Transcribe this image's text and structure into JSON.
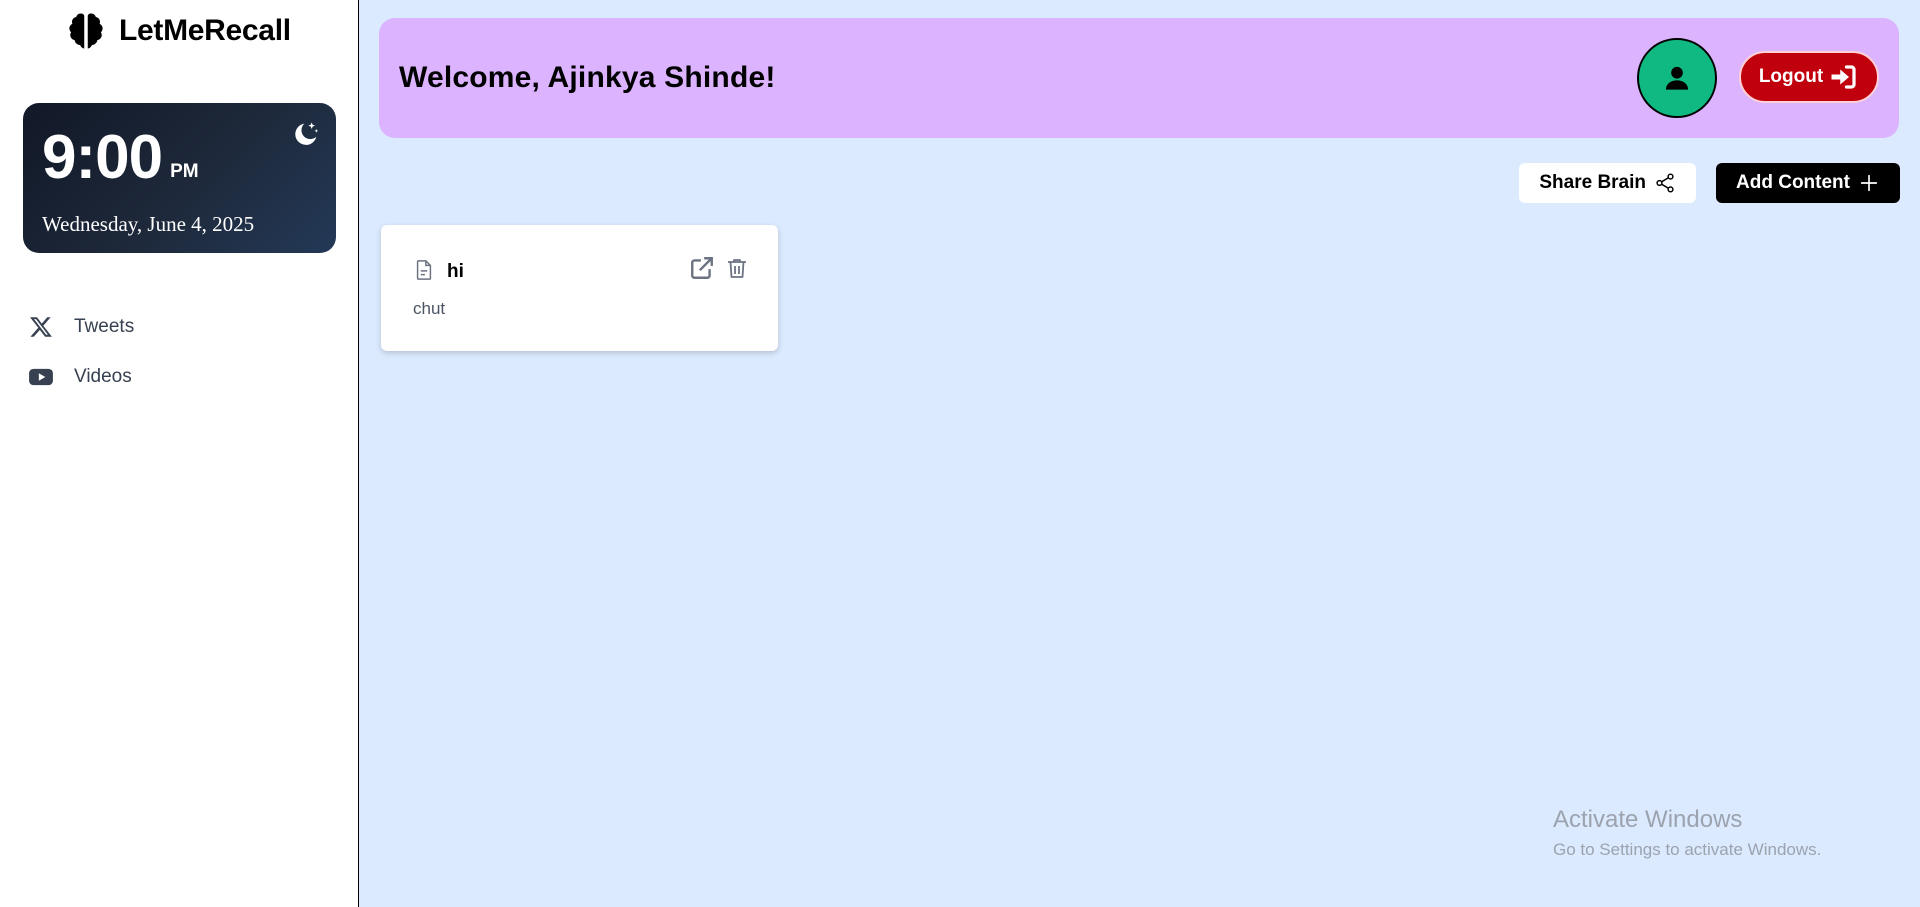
{
  "app": {
    "name": "LetMeRecall"
  },
  "clock": {
    "time": "9:00",
    "ampm": "PM",
    "date": "Wednesday, June 4, 2025"
  },
  "nav": {
    "items": [
      {
        "label": "Tweets",
        "icon": "x-logo-icon"
      },
      {
        "label": "Videos",
        "icon": "youtube-icon"
      }
    ]
  },
  "header": {
    "welcome": "Welcome, Ajinkya Shinde!",
    "logout_label": "Logout"
  },
  "actions": {
    "share_label": "Share Brain",
    "add_label": "Add Content"
  },
  "cards": [
    {
      "title": "hi",
      "body": "chut",
      "icon": "document-icon"
    }
  ],
  "watermark": {
    "title": "Activate Windows",
    "subtitle": "Go to Settings to activate Windows."
  },
  "colors": {
    "sidebar": "#ffffff",
    "main_bg": "#dbeafe",
    "topbar": "#dcb3ff",
    "avatar": "#10b981",
    "logout": "#c0000c",
    "add_button": "#000000"
  }
}
